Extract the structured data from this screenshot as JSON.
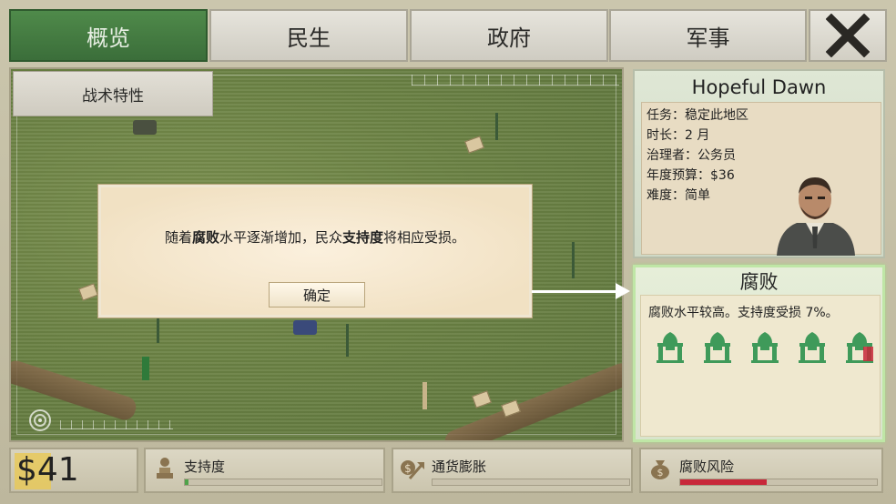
{
  "tabs": [
    {
      "label": "概览",
      "active": true
    },
    {
      "label": "民生",
      "active": false
    },
    {
      "label": "政府",
      "active": false
    },
    {
      "label": "军事",
      "active": false
    }
  ],
  "map": {
    "tactics_label": "战术特性"
  },
  "dialog": {
    "text_before": "随着",
    "bold1": "腐败",
    "text_mid": "水平逐渐增加，民众",
    "bold2": "支持度",
    "text_after": "将相应受损。",
    "ok_label": "确定"
  },
  "info": {
    "name": "Hopeful Dawn",
    "mission": "任务：稳定此地区",
    "duration": "时长：2 月",
    "governor": "治理者：公务员",
    "budget": "年度预算：$36",
    "difficulty": "难度：简单"
  },
  "corruption": {
    "title": "腐败",
    "description": "腐败水平较高。支持度受损 7%。",
    "building_count": 5
  },
  "bottom": {
    "money": "$41",
    "support": {
      "label": "支持度",
      "level": 0.02,
      "color": "#4fa34a"
    },
    "inflation": {
      "label": "通货膨胀",
      "level": 0.0,
      "color": "#4fa34a"
    },
    "corruption_risk": {
      "label": "腐败风险",
      "level": 0.44,
      "color": "#c8283a"
    }
  },
  "colors": {
    "active_tab": "#3f7a3d",
    "corruption_glow": "#bfe6a6",
    "building_green": "#3f9a5a"
  }
}
